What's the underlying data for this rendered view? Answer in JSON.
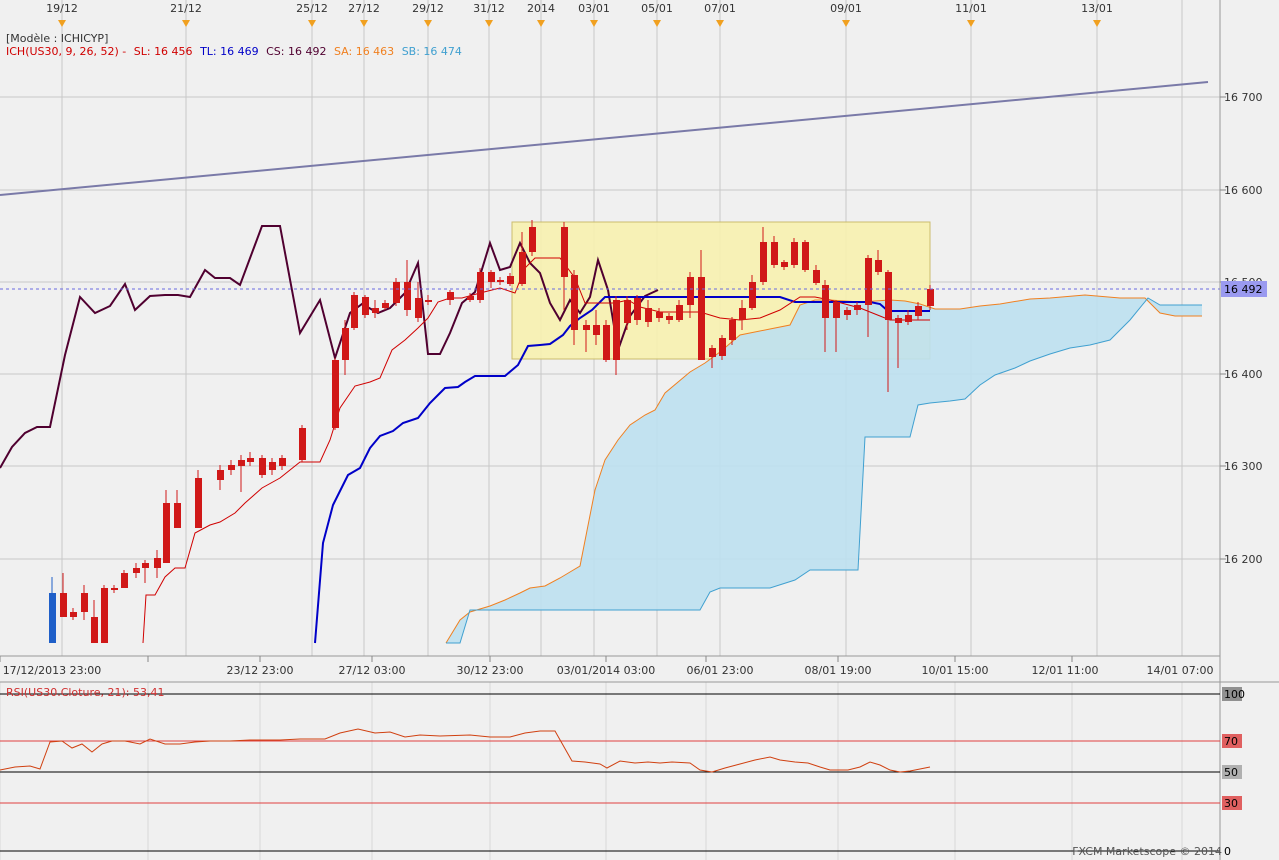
{
  "model_label": "[Modèle : ICHICYP]",
  "ich_legend": {
    "name": "ICH(US30, 9, 26, 52) -",
    "sl": "SL: 16 456",
    "tl": "TL: 16 469",
    "cs": "CS: 16 492",
    "sa": "SA: 16 463",
    "sb": "SB: 16 474"
  },
  "rsi_legend": "RSI(US30.Cloture, 21): 53,41",
  "copyright": "FXCM Marketscope © 2014",
  "colors": {
    "background": "#f0f0f0",
    "grid": "#c8c8c8",
    "tenkan": "#d00000",
    "kijun": "#0000c8",
    "chikou": "#500030",
    "senkou_a": "#f08020",
    "senkou_b": "#40a0d0",
    "cloud_bull": "#bde0ef",
    "candle_up": "#1f5fc8",
    "candle_down": "#d01818",
    "rsi_line": "#d04010",
    "trendline": "#7a7aa8",
    "zone": "#f8f2b0",
    "marker": "#f0a020"
  },
  "top_date_markers": [
    "19/12",
    "21/12",
    "25/12",
    "27/12",
    "29/12",
    "31/12",
    "2014",
    "03/01",
    "05/01",
    "07/01",
    "09/01",
    "11/01",
    "13/01"
  ],
  "bottom_time_labels": [
    "17/12/2013 23:00",
    "23/12 23:00",
    "27/12 03:00",
    "30/12 23:00",
    "03/01/2014 03:00",
    "06/01 23:00",
    "08/01 19:00",
    "10/01 15:00",
    "12/01 11:00",
    "14/01 07:00"
  ],
  "price_axis": {
    "labels": [
      "16 700",
      "16 600",
      "16 500",
      "16 400",
      "16 300",
      "16 200"
    ],
    "current_price": "16 492",
    "ylim": [
      16107,
      16792
    ]
  },
  "rsi_axis": {
    "labels": [
      "100",
      "70",
      "50",
      "30",
      "0"
    ],
    "current_value": "53,41"
  }
}
